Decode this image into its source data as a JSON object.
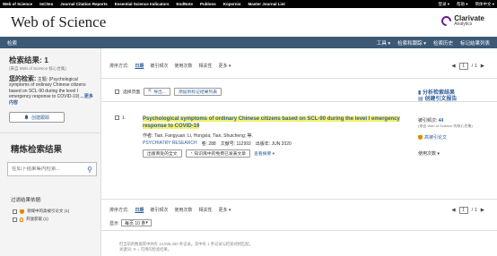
{
  "topbar": {
    "links": [
      "Web of Science",
      "InCites",
      "Journal Citation Reports",
      "Essential Science Indicators",
      "EndNote",
      "Publons",
      "Kopernio",
      "Master Journal List"
    ],
    "right": [
      "登录 ▾",
      "帮助 ▾",
      "简体中文 ▾"
    ]
  },
  "brand": {
    "title": "Web of Science",
    "logo_line1": "Clarivate",
    "logo_line2": "Analytics"
  },
  "nav": {
    "left": "检索",
    "right": [
      "工具 ▾",
      "检索和跟踪 ▾",
      "检索历史",
      "标记结果列表"
    ]
  },
  "sidebar": {
    "title": "检索结果: 1",
    "subtitle": "(来自 Web of Science 核心合集)",
    "query_label": "您的检索:",
    "query_text": "主题: (Psychological symptoms of ordinary Chinese citizens based on SCL-90 during the level I emergency response to COVID-19)",
    "more": "...更多内容",
    "alert_button": "创建跟踪",
    "alert_icon": "bell-icon",
    "refine_title": "精炼检索结果",
    "refine_placeholder": "在如下结果集内检索...",
    "filter_label": "过滤结果依据:",
    "filters": [
      {
        "label": "领域中的高被引论文 (1)"
      },
      {
        "label": "开放获取 (1)"
      }
    ]
  },
  "main": {
    "sort_label": "排序方式:",
    "sort_options": [
      "日期",
      "被引频次",
      "使用次数",
      "相关性",
      "更多 ▾"
    ],
    "page_current": "1",
    "page_total": "/ 1",
    "select_page": "选择页面",
    "export_button": "导出...",
    "add_marked_button": "添加到标记结果列表",
    "record": {
      "number": "1.",
      "title": "Psychological symptoms of ordinary Chinese citizens based on SCL-90 during the level I emergency response to COVID-19",
      "authors": "作者: Tian, Fangyuan; Li, Hongxia; Tian, Shuicheng; 等.",
      "journal": "PSYCHIATRY RESEARCH",
      "volume": "卷: 288",
      "article": "文献号: 112992",
      "date": "出版年: JUN 2020",
      "btn_fulltext": "出版商处的全文",
      "btn_free": "知识库中的免费已发表文章",
      "abstract_link": "查看摘要 ▾"
    },
    "right": {
      "analyze": "分析检索结果",
      "report": "创建引文报告",
      "cited_label": "被引频次:",
      "cited_value": "44",
      "cited_sub": "(来自 Web of Science 的核心合集)",
      "hcp": "高被引论文",
      "usage": "使用次数 ▾"
    },
    "show_label": "显示",
    "show_value": "每页 10 条",
    "footnote_line1": "但当前的数据库中共有 14,936,450 条记录。其中有 1 条记录与检索式相匹配。",
    "footnote_line2": "关键词: ✕ = 可用的检索结果。"
  }
}
